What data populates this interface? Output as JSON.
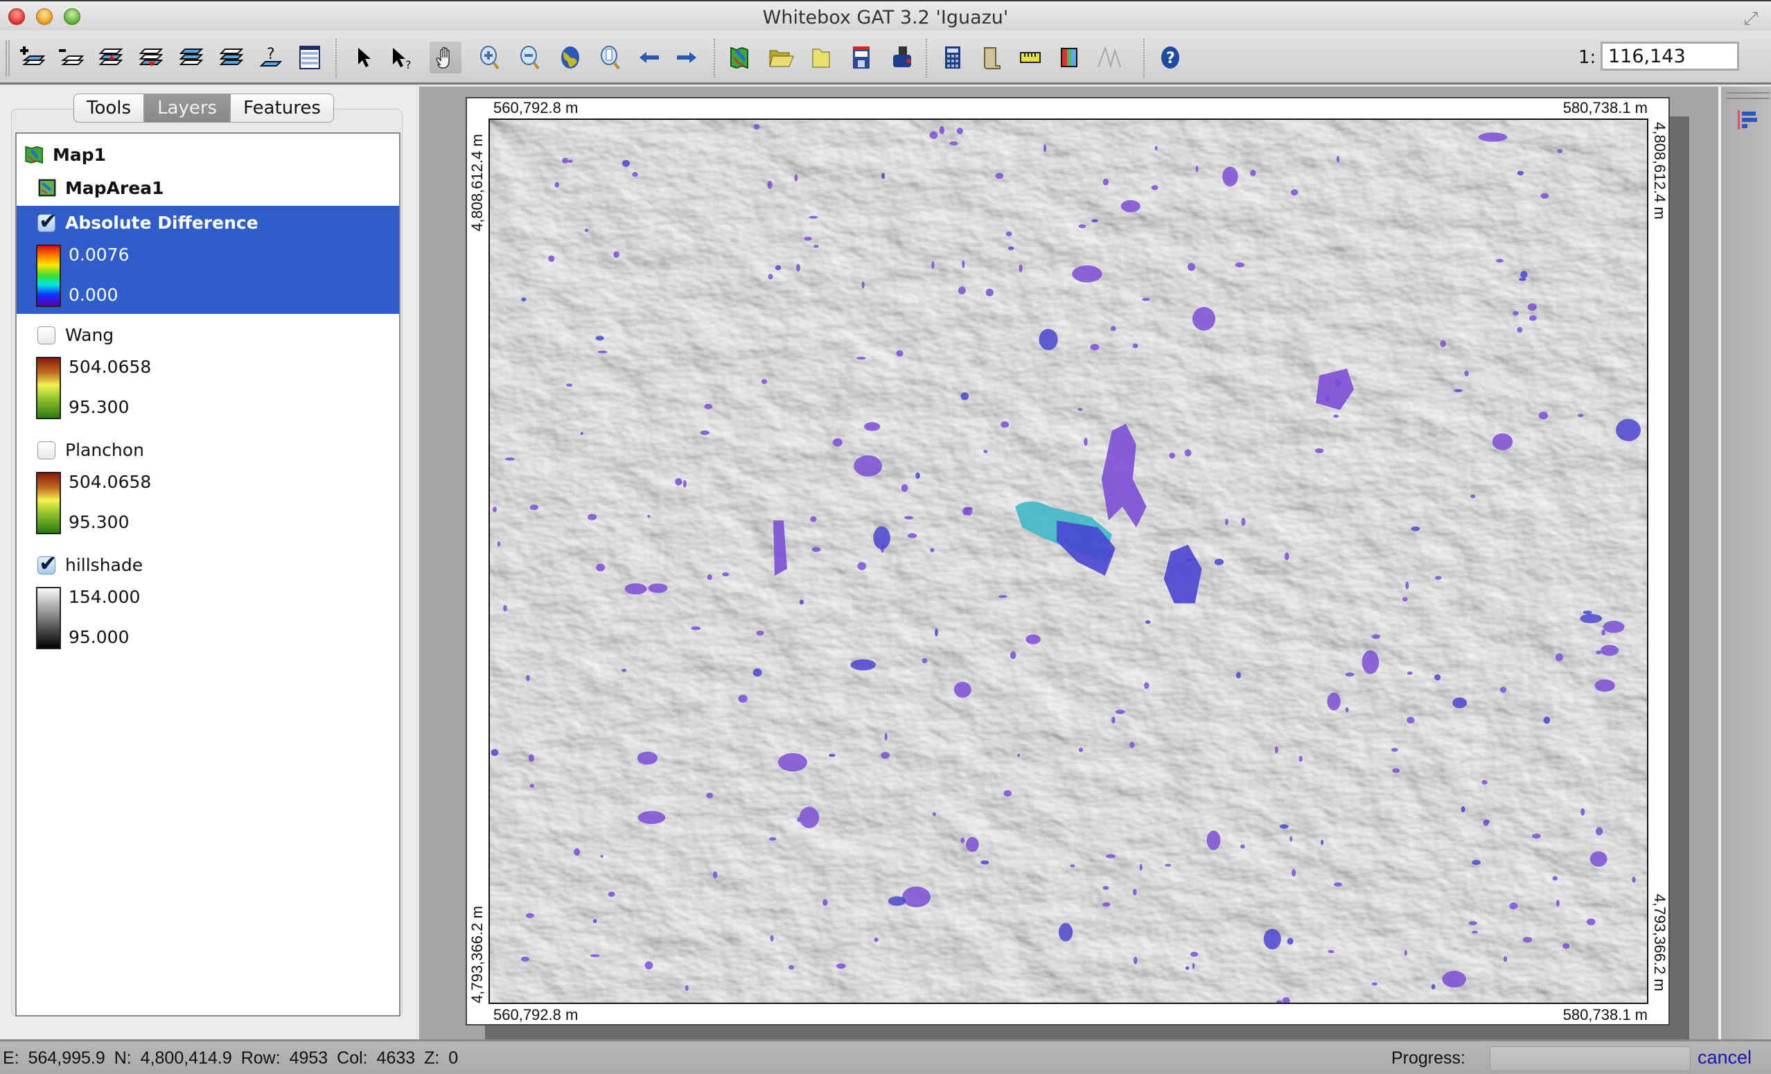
{
  "window": {
    "title": "Whitebox GAT 3.2 'Iguazu'",
    "controls": [
      "close",
      "minimize",
      "zoom"
    ]
  },
  "toolbar": {
    "buttons": [
      {
        "name": "add-layer",
        "icon": "add-layer-icon"
      },
      {
        "name": "remove-layer",
        "icon": "remove-layer-icon"
      },
      {
        "name": "raise-layer",
        "icon": "raise-layer-icon"
      },
      {
        "name": "lower-layer",
        "icon": "lower-layer-icon"
      },
      {
        "name": "layer-to-top",
        "icon": "layer-to-top-icon"
      },
      {
        "name": "layer-to-bottom",
        "icon": "layer-to-bottom-icon"
      },
      {
        "name": "layer-properties",
        "icon": "layer-query-icon"
      },
      {
        "name": "attribute-table",
        "icon": "table-icon"
      },
      {
        "name": "select",
        "icon": "pointer-icon"
      },
      {
        "name": "identify",
        "icon": "pointer-question-icon"
      },
      {
        "name": "pan",
        "icon": "hand-icon",
        "active": true
      },
      {
        "name": "zoom-in",
        "icon": "zoom-in-icon"
      },
      {
        "name": "zoom-out",
        "icon": "zoom-out-icon"
      },
      {
        "name": "zoom-full-extent",
        "icon": "globe-icon"
      },
      {
        "name": "zoom-to-page",
        "icon": "zoom-page-icon"
      },
      {
        "name": "previous-extent",
        "icon": "arrow-left-icon"
      },
      {
        "name": "next-extent",
        "icon": "arrow-right-icon"
      },
      {
        "name": "new-map",
        "icon": "map-icon"
      },
      {
        "name": "open-map",
        "icon": "folder-open-icon"
      },
      {
        "name": "open-folder",
        "icon": "folder-icon"
      },
      {
        "name": "save-map",
        "icon": "floppy-icon"
      },
      {
        "name": "print-map",
        "icon": "printer-icon"
      },
      {
        "name": "raster-calculator",
        "icon": "calculator-icon"
      },
      {
        "name": "scripter",
        "icon": "scroll-icon"
      },
      {
        "name": "measure",
        "icon": "ruler-icon"
      },
      {
        "name": "palette-manager",
        "icon": "palette-icon"
      },
      {
        "name": "profile",
        "icon": "profile-icon",
        "disabled": true
      },
      {
        "name": "help",
        "icon": "help-icon"
      }
    ],
    "scale_prefix": "1:",
    "scale_value": "116,143"
  },
  "left_panel": {
    "tabs": [
      {
        "label": "Tools",
        "active": false
      },
      {
        "label": "Layers",
        "active": true
      },
      {
        "label": "Features",
        "active": false
      }
    ],
    "tree": {
      "map": "Map1",
      "map_area": "MapArea1",
      "layers": [
        {
          "name": "Absolute Difference",
          "visible": true,
          "selected": true,
          "palette": "rainbow",
          "max": "0.0076",
          "min": "0.000"
        },
        {
          "name": "Wang",
          "visible": false,
          "selected": false,
          "palette": "dem",
          "max": "504.0658",
          "min": "95.300"
        },
        {
          "name": "Planchon",
          "visible": false,
          "selected": false,
          "palette": "dem",
          "max": "504.0658",
          "min": "95.300"
        },
        {
          "name": "hillshade",
          "visible": true,
          "selected": false,
          "palette": "grey",
          "max": "154.000",
          "min": "95.000"
        }
      ]
    }
  },
  "map": {
    "top_left_easting": "560,792.8 m",
    "top_right_easting": "580,738.1 m",
    "bottom_left_easting": "560,792.8 m",
    "bottom_right_easting": "580,738.1 m",
    "top_northing_left": "4,808,612.4 m",
    "top_northing_right": "4,808,612.4 m",
    "bottom_northing_left": "4,793,366.2 m",
    "bottom_northing_right": "4,793,366.2 m",
    "overlay_colors": {
      "purple": "#7a4fd6",
      "blue": "#4a46d0",
      "teal": "#3fb8c8"
    }
  },
  "status": {
    "coords": "E: 564,995.9  N: 4,800,414.9  Row: 4953  Col: 4633  Z: 0",
    "progress_label": "Progress:",
    "progress": 0,
    "cancel_label": "cancel"
  },
  "colors": {
    "selection": "#2f5ecb",
    "link": "#1a1aa8"
  }
}
